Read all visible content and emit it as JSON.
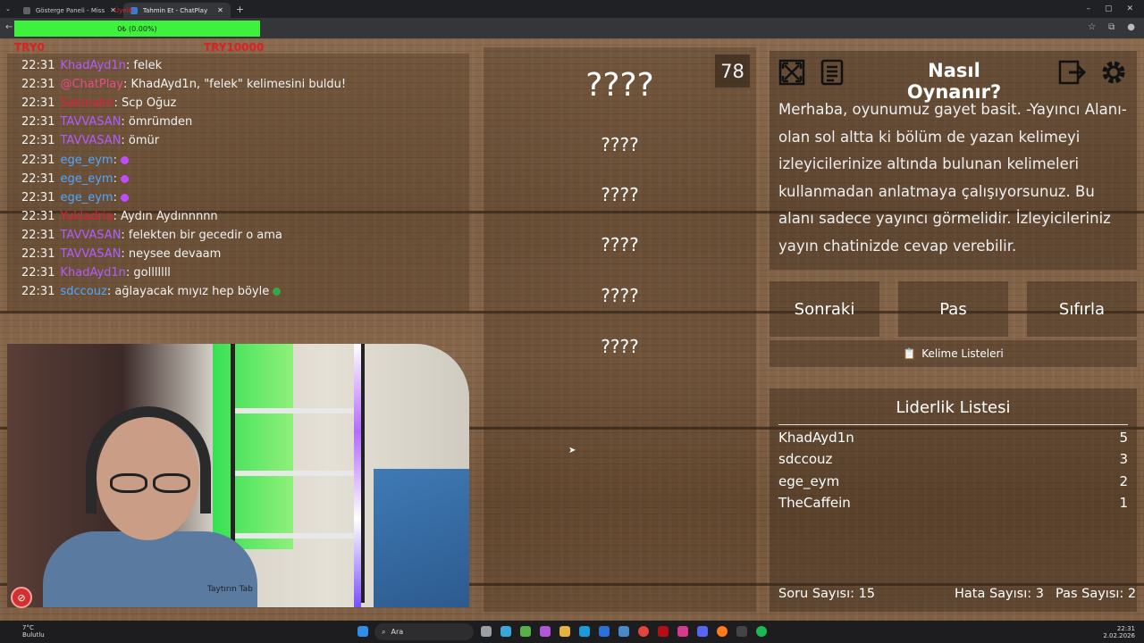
{
  "browser": {
    "tabs": [
      {
        "label": "Gösterge Paneli - MissXss AI Ilk..."
      },
      {
        "label": "Tahmin Et - ChatPlay"
      }
    ],
    "new_tab": "+",
    "window_controls": [
      "–",
      "▢",
      "✕"
    ]
  },
  "overlay": {
    "progress_label": "0₺ (0.00%)",
    "progress_fraction": 0.0,
    "progress_color": "#3df23d",
    "try_left": "TRY0",
    "try_right": "TRY10000",
    "red_text": "Üyelik"
  },
  "chat": [
    {
      "time": "22:31",
      "user": "KhadAyd1n",
      "user_color": "#b05cff",
      "text": ": felek"
    },
    {
      "time": "22:31",
      "user": "@ChatPlay",
      "user_color": "#e94b8a",
      "text": ": KhadAyd1n, \"felek\" kelimesini buldu!"
    },
    {
      "time": "22:31",
      "user": "Sakinakri",
      "user_color": "#e0203a",
      "text": ": Scp Oğuz"
    },
    {
      "time": "22:31",
      "user": "TAVVASAN",
      "user_color": "#b05cff",
      "text": ": ömrümden"
    },
    {
      "time": "22:31",
      "user": "TAVVASAN",
      "user_color": "#b05cff",
      "text": ": ömür"
    },
    {
      "time": "22:31",
      "user": "ege_eym",
      "user_color": "#4fa6ff",
      "text": ":",
      "emote": "#c04cff"
    },
    {
      "time": "22:31",
      "user": "ege_eym",
      "user_color": "#4fa6ff",
      "text": ":",
      "emote": "#c04cff"
    },
    {
      "time": "22:31",
      "user": "ege_eym",
      "user_color": "#4fa6ff",
      "text": ":",
      "emote": "#c04cff"
    },
    {
      "time": "22:31",
      "user": "Yukladria",
      "user_color": "#e0203a",
      "text": ": Aydın Aydınnnnn"
    },
    {
      "time": "22:31",
      "user": "TAVVASAN",
      "user_color": "#b05cff",
      "text": ": felekten bir gecedir o ama"
    },
    {
      "time": "22:31",
      "user": "TAVVASAN",
      "user_color": "#b05cff",
      "text": ": neysee devaam"
    },
    {
      "time": "22:31",
      "user": "KhadAyd1n",
      "user_color": "#b05cff",
      "text": ": golllllll"
    },
    {
      "time": "22:31",
      "user": "sdccouz",
      "user_color": "#4fa6ff",
      "text": ": ağlayacak mıyız hep böyle",
      "emote": "#3aa64a"
    }
  ],
  "cam": {
    "label": "Taytırın Tab"
  },
  "game": {
    "counter": "78",
    "main_word": "????",
    "words": [
      "????",
      "????",
      "????",
      "????",
      "????"
    ]
  },
  "help": {
    "title": "Nasıl Oynanır?",
    "text": "Merhaba, oyunumuz gayet basit. -Yayıncı Alanı- olan sol altta ki bölüm de yazan kelimeyi izleyicilerinize altında bulunan kelimeleri kullanmadan anlatmaya çalışıyorsunuz. Bu alanı sadece yayıncı görmelidir. İzleyicileriniz yayın chatinizde cevap verebilir."
  },
  "buttons": {
    "next": "Sonraki",
    "pass": "Pas",
    "reset": "Sıfırla"
  },
  "word_lists": {
    "icon": "📋",
    "label": "Kelime Listeleri"
  },
  "leaderboard": {
    "title": "Liderlik Listesi",
    "rows": [
      {
        "name": "KhadAyd1n",
        "score": "5"
      },
      {
        "name": "sdccouz",
        "score": "3"
      },
      {
        "name": "ege_eym",
        "score": "2"
      },
      {
        "name": "TheCaffein",
        "score": "1"
      }
    ]
  },
  "stats": {
    "questions": "Soru Sayısı: 15",
    "errors": "Hata Sayısı: 3",
    "passes": "Pas Sayısı: 2"
  },
  "taskbar": {
    "weather_temp": "7°C",
    "weather_desc": "Bulutlu",
    "search_placeholder": "Ara",
    "time": "22:31",
    "date": "2.02.2026"
  }
}
